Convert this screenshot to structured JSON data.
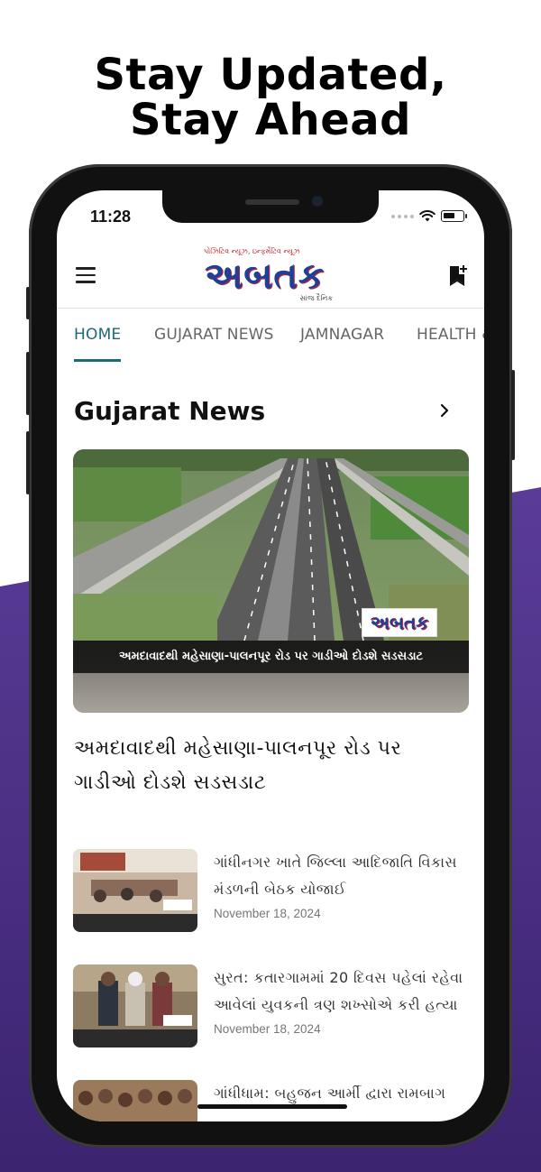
{
  "headline": {
    "line1": "Stay Updated,",
    "line2": "Stay Ahead"
  },
  "status_bar": {
    "time": "11:28"
  },
  "header": {
    "logo_tagline": "પોઝિટિવ ન્યૂઝ, ઇન્ફર્મેટિવ ન્યૂઝ",
    "logo_word": "અબતક",
    "logo_sub": "સાંજ દૈનિક"
  },
  "tabs": [
    {
      "label": "HOME",
      "active": true
    },
    {
      "label": "GUJARAT NEWS",
      "active": false
    },
    {
      "label": "JAMNAGAR",
      "active": false
    },
    {
      "label": "HEALTH &",
      "active": false
    }
  ],
  "section": {
    "title": "Gujarat News"
  },
  "hero": {
    "caption": "અમદાવાદથી મહેસાણા-પાલનપૂર રોડ પર ગાડીઓ દોડશે સડસડાટ",
    "badge": "અબતક",
    "title": "અમદાવાદથી મહેસાણા-પાલનપૂર રોડ પર ગાડીઓ દોડશે સડસડાટ"
  },
  "articles": [
    {
      "title": "ગાંધીનગર ખાતે જિલ્લા આદિજાતિ વિકાસ મંડળની બેઠક યોજાઈ",
      "date": "November 18, 2024"
    },
    {
      "title": "સુરત: કતારગામમાં 20 દિવસ પહેલાં રહેવા આવેલાં યુવકની ત્રણ શખ્સોએ કરી હત્યા",
      "date": "November 18, 2024"
    },
    {
      "title": "ગાંધીધામ: બહુજન આર્મી દ્વારા રામબાગ",
      "date": ""
    }
  ],
  "colors": {
    "accent": "#1c6a78",
    "purple": "#4b2f86",
    "brand_blue": "#1f3f99",
    "brand_red": "#c0272d"
  },
  "icons": {
    "menu": "hamburger-icon",
    "bookmark": "bookmark-add-icon",
    "chevron": "chevron-right-icon"
  }
}
